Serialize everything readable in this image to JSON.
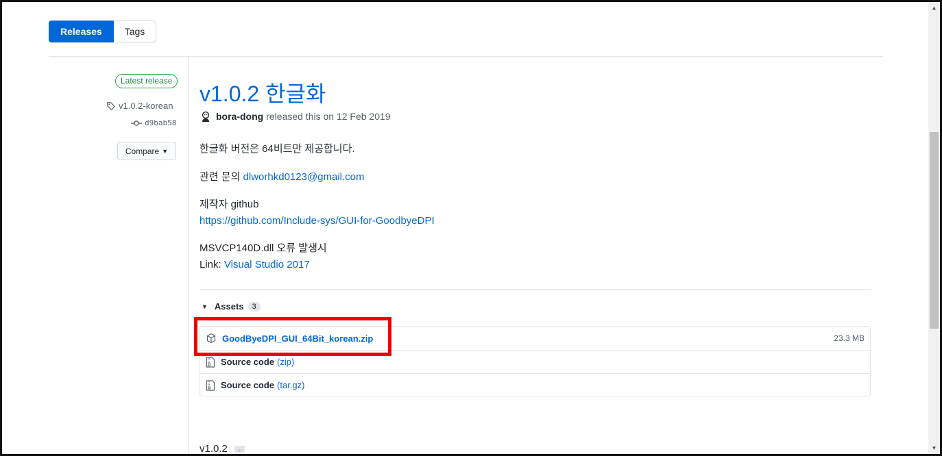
{
  "tabs": {
    "releases": "Releases",
    "tags": "Tags"
  },
  "sidebar": {
    "latest_badge": "Latest release",
    "tag": "v1.0.2-korean",
    "commit": "d9bab58",
    "compare": "Compare"
  },
  "release": {
    "title": "v1.0.2 한글화",
    "author": "bora-dong",
    "released_text": "released this on 12 Feb 2019",
    "body": {
      "line1": "한글화 버전은 64비트만 제공합니다.",
      "contact_prefix": "관련 문의 ",
      "contact_email": "dlworhkd0123@gmail.com",
      "github_label": "제작자 github",
      "github_url": "https://github.com/Include-sys/GUI-for-GoodbyeDPI",
      "msvcp_note": "MSVCP140D.dll 오류 발생시",
      "link_prefix": "Link: ",
      "link_text": "Visual Studio 2017"
    }
  },
  "assets": {
    "label": "Assets",
    "count": "3",
    "items": [
      {
        "name": "GoodByeDPI_GUI_64Bit_korean.zip",
        "size": "23.3 MB"
      },
      {
        "name": "Source code",
        "ext": "(zip)"
      },
      {
        "name": "Source code",
        "ext": "(tar.gz)"
      }
    ]
  },
  "next_release": {
    "title": "v1.0.2",
    "dots": "..."
  },
  "colors": {
    "accent": "#0366d6",
    "highlight": "#ee0000",
    "badge_green": "#28a745"
  }
}
